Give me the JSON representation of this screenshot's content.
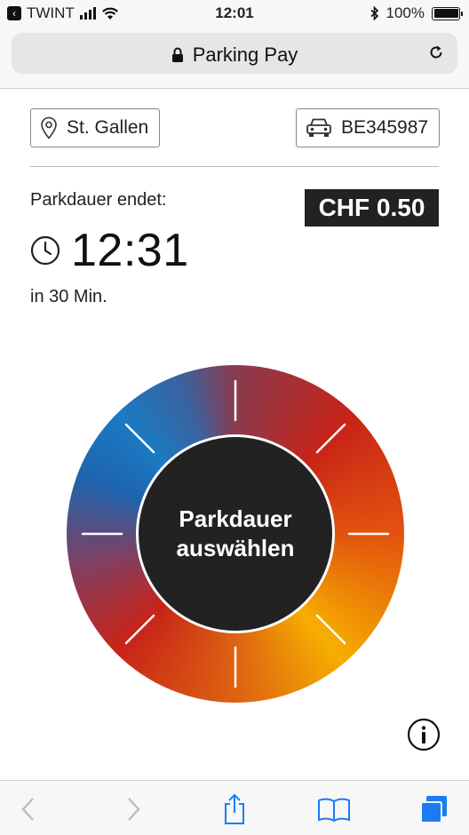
{
  "status_bar": {
    "back_app": "TWINT",
    "time": "12:01",
    "battery": "100%",
    "battery_level": 1.0
  },
  "browser": {
    "title": "Parking Pay"
  },
  "location": {
    "name": "St. Gallen",
    "icon": "map-pin-icon"
  },
  "vehicle": {
    "plate": "BE345987",
    "icon": "car-icon"
  },
  "parking": {
    "ends_label": "Parkdauer endet:",
    "end_time": "12:31",
    "remaining": "in 30 Min.",
    "price": "CHF 0.50"
  },
  "dial": {
    "center_label": "Parkdauer auswählen"
  },
  "colors": {
    "accent_blue": "#1a7ac2",
    "accent_red": "#c82418",
    "accent_orange": "#f6ae00",
    "dark": "#222222",
    "ios_blue": "#1a7cf4"
  },
  "toolbar": {
    "icons": [
      "back-icon",
      "forward-icon",
      "share-icon",
      "bookmarks-icon",
      "tabs-icon"
    ]
  }
}
